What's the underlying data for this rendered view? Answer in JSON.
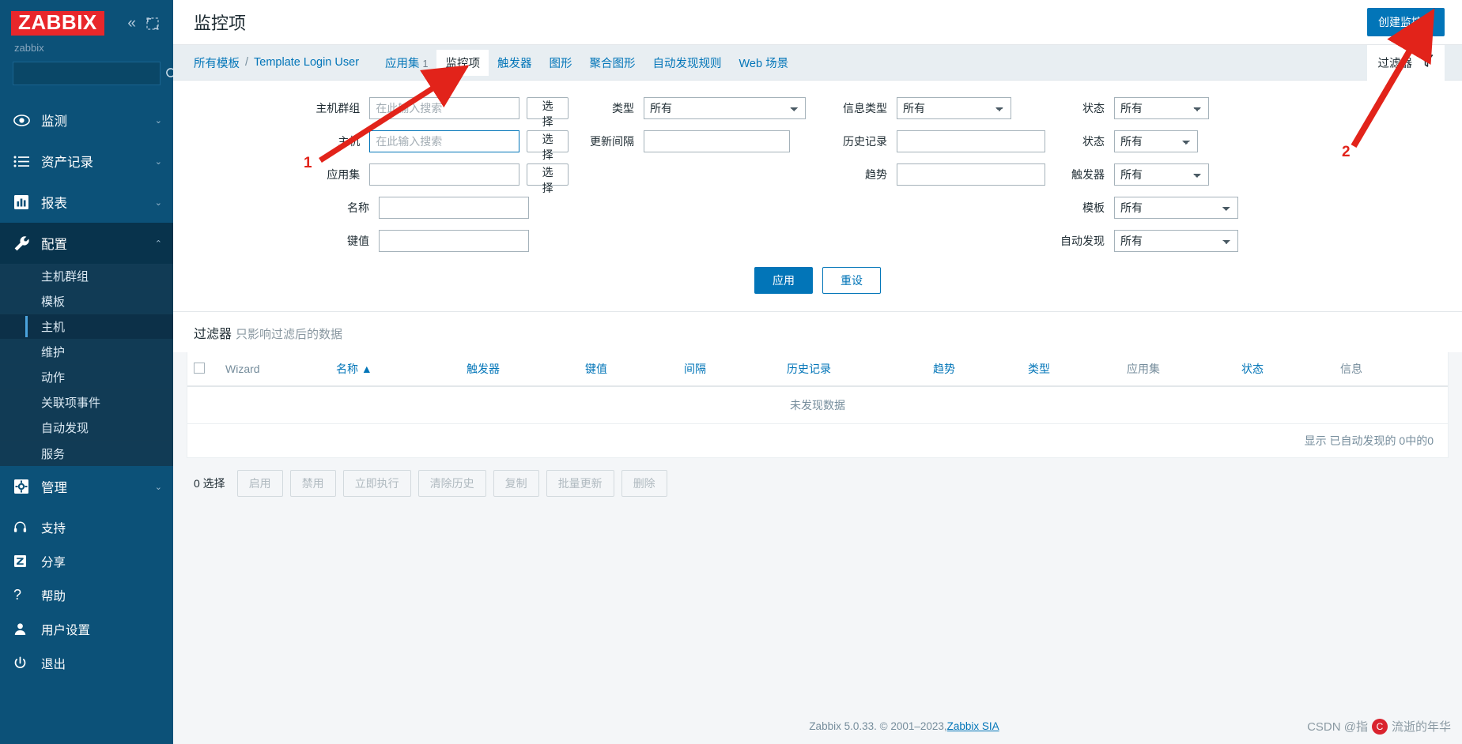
{
  "sidebar": {
    "logo": "ZABBIX",
    "server_name": "zabbix",
    "collapse_icon": "chevron-double-left-icon",
    "expand_icon": "fullscreen-icon",
    "search_placeholder": "",
    "search_value": "",
    "search_icon": "search-icon",
    "nav": [
      {
        "label": "监测",
        "icon": "eye-icon",
        "chevron": "⌄",
        "active": false
      },
      {
        "label": "资产记录",
        "icon": "list-icon",
        "chevron": "⌄",
        "active": false
      },
      {
        "label": "报表",
        "icon": "chart-bar-icon",
        "chevron": "⌄",
        "active": false
      },
      {
        "label": "配置",
        "icon": "wrench-icon",
        "chevron": "⌃",
        "active": true
      }
    ],
    "submenu": [
      {
        "label": "主机群组",
        "active": false
      },
      {
        "label": "模板",
        "active": false
      },
      {
        "label": "主机",
        "active": true
      },
      {
        "label": "维护",
        "active": false
      },
      {
        "label": "动作",
        "active": false
      },
      {
        "label": "关联项事件",
        "active": false
      },
      {
        "label": "自动发现",
        "active": false
      },
      {
        "label": "服务",
        "active": false
      }
    ],
    "admin": {
      "label": "管理",
      "icon": "gear-icon",
      "chevron": "⌄"
    },
    "bottom": [
      {
        "label": "支持",
        "icon": "headset-icon"
      },
      {
        "label": "分享",
        "icon": "zabbix-z-icon"
      },
      {
        "label": "帮助",
        "icon": "question-icon"
      },
      {
        "label": "用户设置",
        "icon": "user-icon"
      },
      {
        "label": "退出",
        "icon": "power-icon"
      }
    ]
  },
  "header": {
    "title": "监控项",
    "create_button": "创建监控项"
  },
  "breadcrumb": {
    "all_templates": "所有模板",
    "separator": "/",
    "template_name": "Template Login User"
  },
  "tabs": [
    {
      "label": "应用集",
      "count": "1",
      "active": false
    },
    {
      "label": "监控项",
      "count": "",
      "active": true
    },
    {
      "label": "触发器",
      "count": "",
      "active": false
    },
    {
      "label": "图形",
      "count": "",
      "active": false
    },
    {
      "label": "聚合图形",
      "count": "",
      "active": false
    },
    {
      "label": "自动发现规则",
      "count": "",
      "active": false
    },
    {
      "label": "Web 场景",
      "count": "",
      "active": false
    }
  ],
  "filter_tab": {
    "label": "过滤器",
    "icon": "funnel-icon"
  },
  "filter": {
    "col1": [
      {
        "label": "主机群组",
        "type": "input",
        "value": "",
        "placeholder": "在此输入搜索",
        "button": "选择",
        "focused": false
      },
      {
        "label": "主机",
        "type": "input",
        "value": "",
        "placeholder": "在此输入搜索",
        "button": "选择",
        "focused": true
      },
      {
        "label": "应用集",
        "type": "input",
        "value": "",
        "placeholder": "",
        "button": "选择",
        "focused": false
      },
      {
        "label": "名称",
        "type": "input",
        "value": "",
        "placeholder": "",
        "button": "",
        "focused": false
      },
      {
        "label": "键值",
        "type": "input",
        "value": "",
        "placeholder": "",
        "button": "",
        "focused": false
      }
    ],
    "col2": [
      {
        "label": "类型",
        "type": "select",
        "value": "所有"
      },
      {
        "label": "更新间隔",
        "type": "input",
        "value": ""
      }
    ],
    "col3": [
      {
        "label": "信息类型",
        "type": "select",
        "value": "所有"
      },
      {
        "label": "历史记录",
        "type": "input",
        "value": ""
      },
      {
        "label": "趋势",
        "type": "input",
        "value": ""
      }
    ],
    "col4": [
      {
        "label": "状态",
        "type": "select",
        "value": "所有"
      },
      {
        "label": "状态",
        "type": "select",
        "value": "所有"
      },
      {
        "label": "触发器",
        "type": "select",
        "value": "所有"
      },
      {
        "label": "模板",
        "type": "select",
        "value": "所有"
      },
      {
        "label": "自动发现",
        "type": "select",
        "value": "所有"
      }
    ],
    "apply": "应用",
    "reset": "重设"
  },
  "filter_note": {
    "title": "过滤器",
    "subtitle": "只影响过滤后的数据"
  },
  "table": {
    "columns": [
      {
        "label": "Wizard",
        "link": false
      },
      {
        "label": "名称 ▲",
        "link": true
      },
      {
        "label": "触发器",
        "link": true
      },
      {
        "label": "键值",
        "link": true
      },
      {
        "label": "间隔",
        "link": true
      },
      {
        "label": "历史记录",
        "link": true
      },
      {
        "label": "趋势",
        "link": true
      },
      {
        "label": "类型",
        "link": true
      },
      {
        "label": "应用集",
        "link": false
      },
      {
        "label": "状态",
        "link": true
      },
      {
        "label": "信息",
        "link": false
      }
    ],
    "empty_text": "未发现数据",
    "paging": "显示 已自动发现的 0中的0"
  },
  "actionbar": {
    "selected": "0 选择",
    "buttons": [
      "启用",
      "禁用",
      "立即执行",
      "清除历史",
      "复制",
      "批量更新",
      "删除"
    ]
  },
  "footer": {
    "text_before": "Zabbix 5.0.33. © 2001–2023, ",
    "link": "Zabbix SIA"
  },
  "watermark": {
    "text_left": "CSDN @指",
    "text_right": "流逝的年华"
  },
  "annotations": [
    {
      "number": "1"
    },
    {
      "number": "2"
    }
  ],
  "colors": {
    "accent": "#0275b8",
    "brand_red": "#e8272b",
    "sidebar": "#0c5178"
  }
}
